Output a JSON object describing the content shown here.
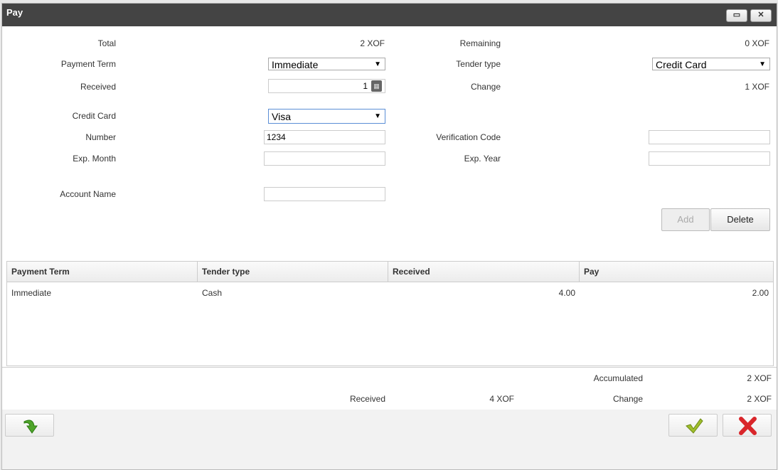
{
  "dialog": {
    "title": "Pay"
  },
  "form": {
    "total_label": "Total",
    "total_value": "2 XOF",
    "remaining_label": "Remaining",
    "remaining_value": "0 XOF",
    "payment_term_label": "Payment Term",
    "payment_term_value": "Immediate",
    "tender_type_label": "Tender type",
    "tender_type_value": "Credit Card",
    "received_label": "Received",
    "received_value": "1",
    "change_label": "Change",
    "change_value": "1 XOF",
    "credit_card_label": "Credit Card",
    "credit_card_value": "Visa",
    "number_label": "Number",
    "number_value": "1234",
    "verification_label": "Verification Code",
    "verification_value": "",
    "exp_month_label": "Exp. Month",
    "exp_month_value": "",
    "exp_year_label": "Exp. Year",
    "exp_year_value": "",
    "account_name_label": "Account Name",
    "account_name_value": "",
    "add_label": "Add",
    "delete_label": "Delete"
  },
  "table": {
    "headers": [
      "Payment Term",
      "Tender type",
      "Received",
      "Pay"
    ],
    "rows": [
      [
        "Immediate",
        "Cash",
        "4.00",
        "2.00"
      ]
    ]
  },
  "summary": {
    "accumulated_label": "Accumulated",
    "accumulated_value": "2 XOF",
    "received_label": "Received",
    "received_value": "4 XOF",
    "change_label": "Change",
    "change_value": "2 XOF"
  },
  "icons": {
    "refresh": "green-arrow-icon",
    "ok": "green-check-icon",
    "cancel": "red-x-icon"
  }
}
